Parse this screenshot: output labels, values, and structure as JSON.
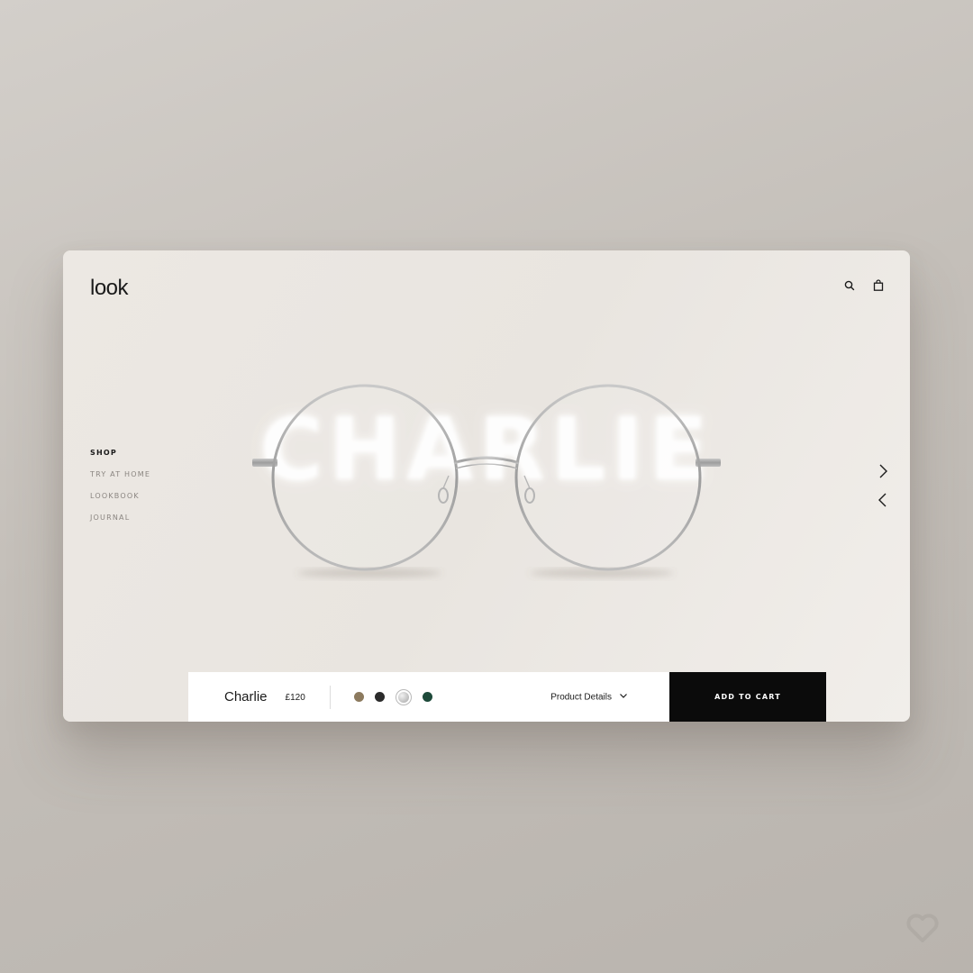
{
  "brand": {
    "logo": "look"
  },
  "nav": {
    "items": [
      {
        "label": "SHOP",
        "active": true
      },
      {
        "label": "TRY AT HOME",
        "active": false
      },
      {
        "label": "LOOKBOOK",
        "active": false
      },
      {
        "label": "JOURNAL",
        "active": false
      }
    ]
  },
  "header": {
    "icons": [
      "search-icon",
      "shopping-bag-icon"
    ]
  },
  "hero": {
    "title": "CHARLIE",
    "arrows": [
      "chevron-right-icon",
      "chevron-left-icon"
    ]
  },
  "product": {
    "name": "Charlie",
    "price": "£120",
    "colors": [
      {
        "name": "tortoise",
        "hex": "#8c7a5e",
        "selected": false
      },
      {
        "name": "black",
        "hex": "#2b2b2b",
        "selected": false
      },
      {
        "name": "silver",
        "hex": "#c8c8c8",
        "selected": true
      },
      {
        "name": "green",
        "hex": "#1e4a3a",
        "selected": false
      }
    ],
    "details_label": "Product Details",
    "add_to_cart_label": "ADD TO CART"
  },
  "colors": {
    "background": "#c6c1bb",
    "card": "#ebe7e2",
    "accent": "#0b0b0b",
    "frame": "#a9a9a9"
  }
}
